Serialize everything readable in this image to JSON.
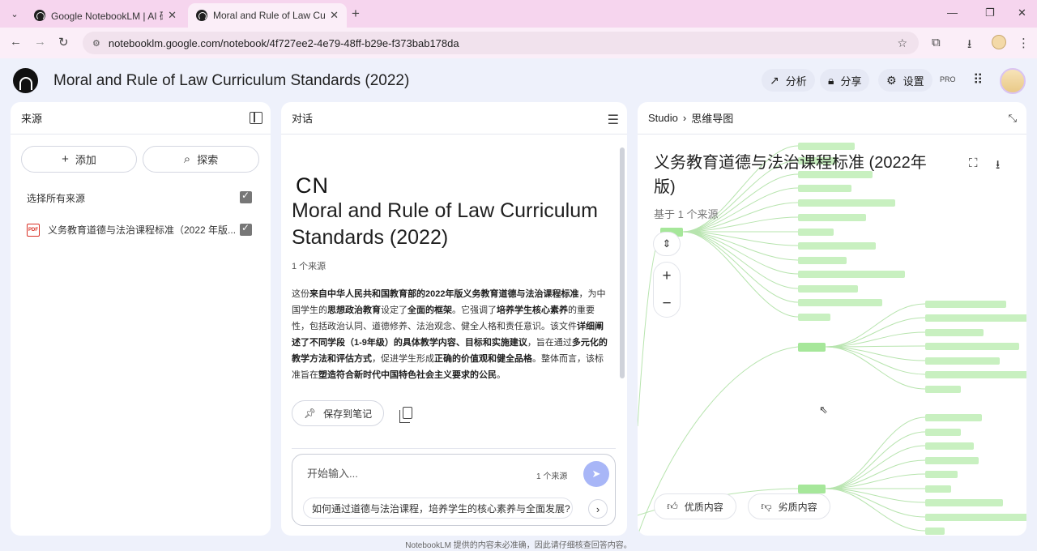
{
  "browser": {
    "tabs": [
      {
        "title": "Google NotebookLM | AI 研究"
      },
      {
        "title": "Moral and Rule of Law Curric"
      }
    ],
    "url": "notebooklm.google.com/notebook/4f727ee2-4e79-48ff-b29e-f373bab178da"
  },
  "header": {
    "title": "Moral and Rule of Law Curriculum Standards (2022)",
    "analyze_label": "分析",
    "share_label": "分享",
    "settings_label": "设置",
    "pro_badge": "PRO"
  },
  "sources": {
    "heading": "来源",
    "add_label": "添加",
    "explore_label": "探索",
    "select_all_label": "选择所有来源",
    "select_all_checked": true,
    "items": [
      {
        "name": "义务教育道德与法治课程标准（2022 年版...",
        "type": "PDF",
        "checked": true
      }
    ]
  },
  "chat": {
    "heading": "对话",
    "emoji_mark": "CN",
    "notebook_title": "Moral and Rule of Law Curriculum Standards (2022)",
    "source_count": "1 个来源",
    "summary": [
      {
        "t": "这份",
        "b": false
      },
      {
        "t": "来自中华人民共和国教育部的2022年版义务教育道德与法治课程标准",
        "b": true
      },
      {
        "t": "，为中国学生的",
        "b": false
      },
      {
        "t": "思想政治教育",
        "b": true
      },
      {
        "t": "设定了",
        "b": false
      },
      {
        "t": "全面的框架",
        "b": true
      },
      {
        "t": "。它强调了",
        "b": false
      },
      {
        "t": "培养学生核心素养",
        "b": true
      },
      {
        "t": "的重要性，包括政治认同、道德修养、法治观念、健全人格和责任意识。该文件",
        "b": false
      },
      {
        "t": "详细阐述了不同学段（1-9年级）的具体教学内容、目标和实施建议",
        "b": true
      },
      {
        "t": "，旨在通过",
        "b": false
      },
      {
        "t": "多元化的教学方法和评估方式",
        "b": true
      },
      {
        "t": "，促进学生形成",
        "b": false
      },
      {
        "t": "正确的价值观和健全品格",
        "b": true
      },
      {
        "t": "。整体而言，该标准旨在",
        "b": false
      },
      {
        "t": "塑造符合新时代中国特色社会主义要求的公民",
        "b": true
      },
      {
        "t": "。",
        "b": false
      }
    ],
    "save_note_label": "保存到笔记",
    "input_placeholder": "开始输入...",
    "input_source_count": "1 个来源",
    "suggestion": "如何通过道德与法治课程，培养学生的核心素养与全面发展?"
  },
  "studio": {
    "crumb_root": "Studio",
    "crumb_current": "思维导图",
    "mindmap_title": "义务教育道德与法治课程标准 (2022年版)",
    "mindmap_subtitle": "基于 1 个来源",
    "good_label": "优质内容",
    "bad_label": "劣质内容"
  },
  "footer": "NotebookLM 提供的内容未必准确，因此请仔细核查回答内容。",
  "colors": {
    "tab_bar": "#f6d5ee",
    "page_bg": "#eef1fb",
    "mindmap_node": "#c8f0c0",
    "send_button": "#a8b6f7"
  }
}
